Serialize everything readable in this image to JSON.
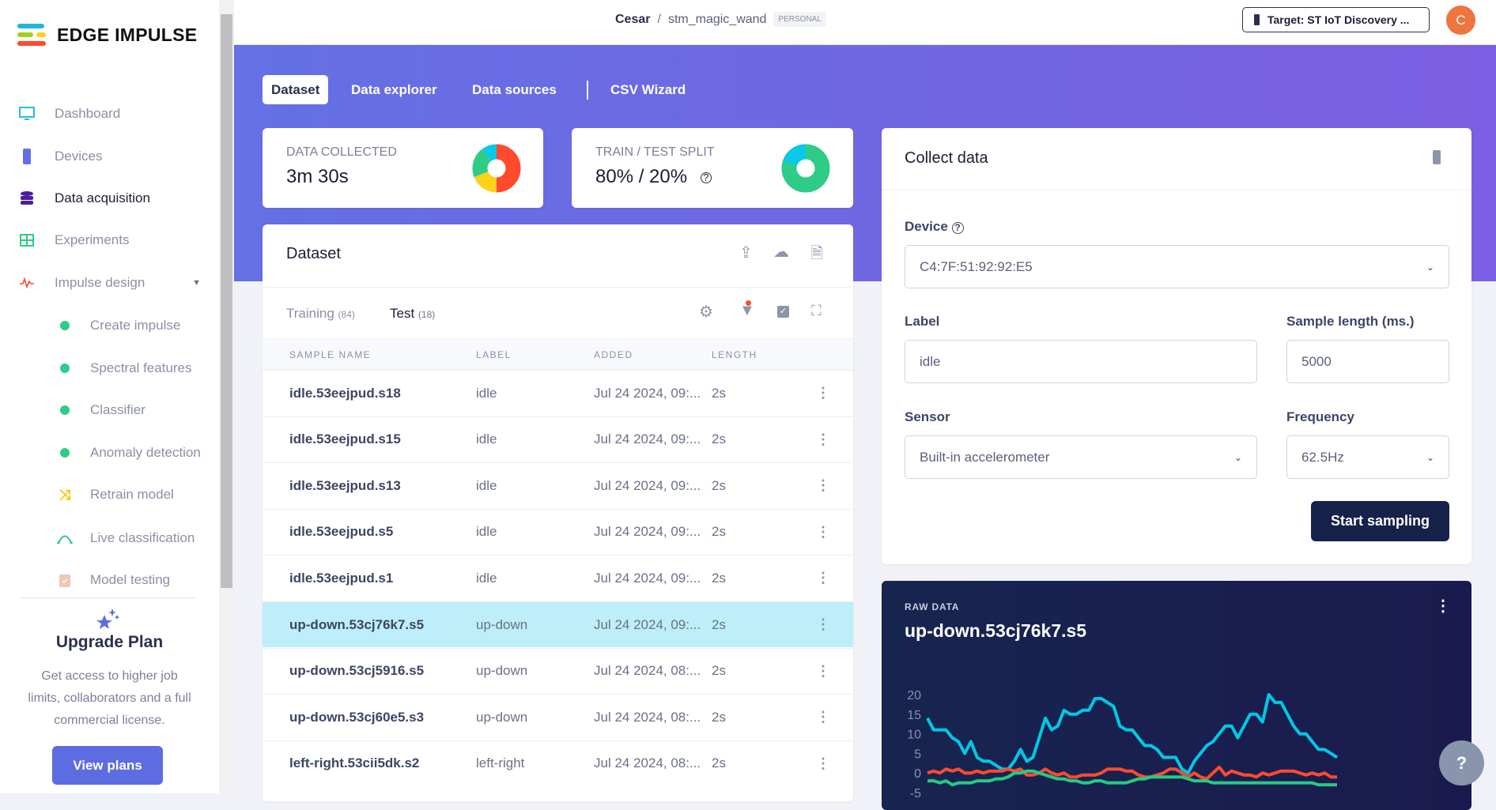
{
  "brand": {
    "name": "EDGE IMPULSE"
  },
  "sidebar": {
    "items": [
      {
        "label": "Dashboard",
        "icon": "monitor-icon"
      },
      {
        "label": "Devices",
        "icon": "chip-icon"
      },
      {
        "label": "Data acquisition",
        "icon": "database-icon",
        "active": true
      },
      {
        "label": "Experiments",
        "icon": "grid-icon"
      },
      {
        "label": "Impulse design",
        "icon": "pulse-icon"
      }
    ],
    "sub_items": [
      {
        "label": "Create impulse"
      },
      {
        "label": "Spectral features"
      },
      {
        "label": "Classifier"
      },
      {
        "label": "Anomaly detection"
      },
      {
        "label": "Retrain model",
        "icon": "shuffle-icon"
      },
      {
        "label": "Live classification",
        "icon": "bezier-icon"
      },
      {
        "label": "Model testing",
        "icon": "clipboard-check-icon"
      }
    ],
    "upgrade": {
      "title": "Upgrade Plan",
      "text1": "Get access to higher job",
      "text2": "limits, collaborators and a full",
      "text3": "commercial license.",
      "button": "View plans"
    }
  },
  "header": {
    "user": "Cesar",
    "sep": "/",
    "project": "stm_magic_wand",
    "badge": "PERSONAL",
    "target": "Target: ST IoT Discovery ...",
    "avatar": "C"
  },
  "tabs": [
    "Dataset",
    "Data explorer",
    "Data sources",
    "CSV Wizard"
  ],
  "stats": {
    "collected_title": "DATA COLLECTED",
    "collected_value": "3m 30s",
    "split_title": "TRAIN / TEST SPLIT",
    "split_value": "80% / 20%"
  },
  "dataset": {
    "title": "Dataset",
    "training_label": "Training",
    "training_count": "(84)",
    "test_label": "Test",
    "test_count": "(18)",
    "columns": [
      "SAMPLE NAME",
      "LABEL",
      "ADDED",
      "LENGTH"
    ],
    "rows": [
      {
        "name": "idle.53eejpud.s18",
        "label": "idle",
        "added": "Jul 24 2024, 09:...",
        "length": "2s"
      },
      {
        "name": "idle.53eejpud.s15",
        "label": "idle",
        "added": "Jul 24 2024, 09:...",
        "length": "2s"
      },
      {
        "name": "idle.53eejpud.s13",
        "label": "idle",
        "added": "Jul 24 2024, 09:...",
        "length": "2s"
      },
      {
        "name": "idle.53eejpud.s5",
        "label": "idle",
        "added": "Jul 24 2024, 09:...",
        "length": "2s"
      },
      {
        "name": "idle.53eejpud.s1",
        "label": "idle",
        "added": "Jul 24 2024, 09:...",
        "length": "2s"
      },
      {
        "name": "up-down.53cj76k7.s5",
        "label": "up-down",
        "added": "Jul 24 2024, 09:...",
        "length": "2s",
        "selected": true
      },
      {
        "name": "up-down.53cj5916.s5",
        "label": "up-down",
        "added": "Jul 24 2024, 08:...",
        "length": "2s"
      },
      {
        "name": "up-down.53cj60e5.s3",
        "label": "up-down",
        "added": "Jul 24 2024, 08:...",
        "length": "2s"
      },
      {
        "name": "left-right.53cii5dk.s2",
        "label": "left-right",
        "added": "Jul 24 2024, 08:...",
        "length": "2s"
      }
    ]
  },
  "collect": {
    "title": "Collect data",
    "device_label": "Device",
    "device_value": "C4:7F:51:92:92:E5",
    "label_label": "Label",
    "label_value": "idle",
    "length_label": "Sample length (ms.)",
    "length_value": "5000",
    "sensor_label": "Sensor",
    "sensor_value": "Built-in accelerometer",
    "freq_label": "Frequency",
    "freq_value": "62.5Hz",
    "start_button": "Start sampling"
  },
  "raw": {
    "kicker": "RAW DATA",
    "title": "up-down.53cj76k7.s5"
  },
  "colors": {
    "accent": "#5d6ce1",
    "dark": "#1a1f4e",
    "series": [
      "#00c8e6",
      "#ff4a2e",
      "#23cc84"
    ]
  },
  "chart_data": {
    "type": "line",
    "yticks": [
      "20",
      "15",
      "10",
      "5",
      "0",
      "-5"
    ],
    "ylim": [
      -5,
      20
    ],
    "series": [
      {
        "values": [
          14,
          11,
          11,
          11,
          9,
          8,
          5,
          8,
          4,
          3,
          3,
          2,
          1,
          1,
          3,
          6,
          3,
          4,
          9,
          14,
          11,
          12,
          16,
          15,
          15,
          16,
          16,
          19,
          19,
          18,
          17,
          12,
          11,
          11,
          9,
          7,
          7,
          6,
          4,
          4,
          4,
          1,
          0,
          3,
          5,
          7,
          8,
          10,
          12,
          12,
          9,
          12,
          15,
          15,
          13,
          20,
          18,
          18,
          15,
          12,
          10,
          10,
          8,
          6,
          6,
          5,
          4
        ]
      },
      {
        "values": [
          0,
          0.5,
          0,
          1,
          0.5,
          1,
          0,
          0,
          0.5,
          0,
          0.5,
          0.5,
          0.5,
          1,
          0.5,
          1,
          -0.5,
          -0.5,
          0,
          1,
          0,
          -0.5,
          0,
          -1,
          -1,
          -0.5,
          -0.5,
          -0.5,
          0,
          1,
          1,
          1,
          0.5,
          0.5,
          -0.5,
          -1,
          -1,
          -0.5,
          0,
          1,
          1,
          0,
          -1,
          0,
          -1,
          -1.5,
          0,
          1.5,
          -0.5,
          0.5,
          0,
          -0.5,
          -0.5,
          -1,
          0,
          -0.5,
          0,
          0.5,
          0.5,
          0.5,
          0,
          -0.5,
          0,
          -0.5,
          0,
          -1,
          -1
        ]
      },
      {
        "values": [
          -2,
          -2,
          -2.5,
          -2,
          -3,
          -2.5,
          -2.5,
          -2.5,
          -2,
          -2,
          -2,
          -1.5,
          -1.5,
          -1,
          0,
          0,
          0.5,
          0.5,
          0,
          -0.5,
          -1,
          -1.5,
          -1.5,
          -2,
          -2,
          -2.5,
          -2.5,
          -2,
          -2,
          -2.5,
          -2.5,
          -2.5,
          -2.5,
          -2,
          -1.5,
          -1.5,
          -1,
          -1,
          -1,
          -1,
          -1,
          -1,
          -1.5,
          -2,
          -2,
          -2,
          -2.5,
          -2.5,
          -2.5,
          -2.5,
          -2.5,
          -2.5,
          -2.5,
          -2.5,
          -2.5,
          -2.5,
          -2.5,
          -2.5,
          -2.5,
          -2.5,
          -2.5,
          -2.5,
          -2.5,
          -3,
          -3,
          -3,
          -3
        ]
      }
    ]
  }
}
